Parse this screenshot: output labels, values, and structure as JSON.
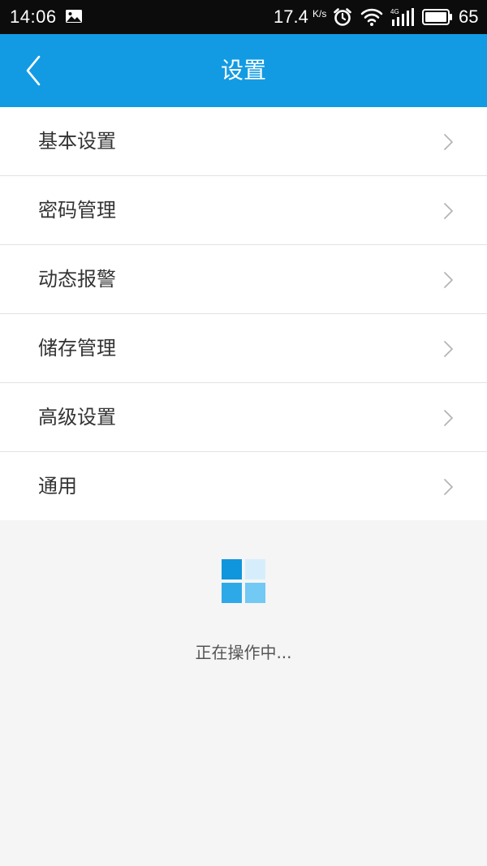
{
  "status_bar": {
    "time": "14:06",
    "net_speed": "17.4",
    "net_speed_unit": "K/s",
    "network_type": "4G",
    "battery": "65",
    "icons": [
      "photo-icon",
      "alarm-icon",
      "wifi-icon",
      "signal-4g-icon",
      "battery-icon"
    ]
  },
  "header": {
    "title": "设置",
    "back_icon": "chevron-left-icon"
  },
  "settings": {
    "items": [
      {
        "label": "基本设置"
      },
      {
        "label": "密码管理"
      },
      {
        "label": "动态报警"
      },
      {
        "label": "储存管理"
      },
      {
        "label": "高级设置"
      },
      {
        "label": "通用"
      }
    ],
    "item_icon": "chevron-right-icon"
  },
  "loading": {
    "text": "正在操作中...",
    "icon": "loading-grid-icon"
  },
  "colors": {
    "accent": "#129be3",
    "status_bar": "#0c0c0c",
    "background": "#f5f5f5",
    "list_background": "#ffffff",
    "divider": "#e2e2e2",
    "loading_cells": [
      "#0f96dd",
      "#d6eefb",
      "#2ea9e7",
      "#71c9f4"
    ]
  }
}
